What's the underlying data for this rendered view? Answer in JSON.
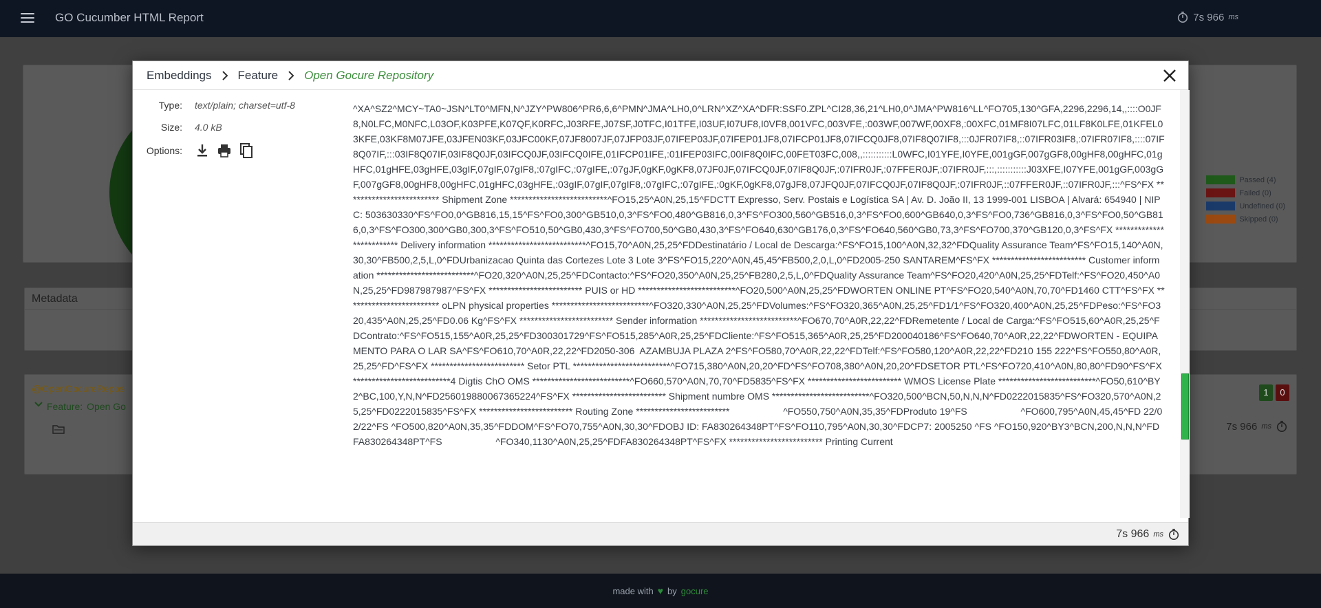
{
  "header": {
    "title": "GO Cucumber HTML Report",
    "time_value": "7s 966",
    "time_unit": "ms"
  },
  "background": {
    "legend": [
      {
        "label": "Passed (4)",
        "color": "#1f5a1b"
      },
      {
        "label": "Failed (0)",
        "color": "#6a1414"
      },
      {
        "label": "Undefined (0)",
        "color": "#1a3a6a"
      },
      {
        "label": "Skipped (0)",
        "color": "#9a4a10"
      }
    ],
    "metadata_title": "Metadata",
    "feature_tag": "@OpenGocureRepos",
    "feature_label": "Feature:",
    "feature_name": "Open Go",
    "passed_count": "1",
    "failed_count": "0",
    "feature_time": "7s 966",
    "feature_time_unit": "ms"
  },
  "modal": {
    "breadcrumb": [
      "Embeddings",
      "Feature",
      "Open Gocure Repository"
    ],
    "type_label": "Type:",
    "type_value": "text/plain; charset=utf-8",
    "size_label": "Size:",
    "size_value": "4.0 kB",
    "options_label": "Options:",
    "options": [
      "download-icon",
      "print-icon",
      "copy-icon"
    ],
    "content": "^XA^SZ2^MCY~TA0~JSN^LT0^MFN,N^JZY^PW806^PR6,6,6^PMN^JMA^LH0,0^LRN^XZ^XA^DFR:SSF0.ZPL^CI28,36,21^LH0,0^JMA^PW816^LL^FO705,130^GFA,2296,2296,14,,::::O0JF8,N0LFC,M0NFC,L03OF,K03PFE,K07QF,K0RFC,J03RFE,J07SF,J0TFC,I01TFE,I03UF,I07UF8,I0VF8,001VFC,003VFE,:003WF,007WF,00XF8,:00XFC,01MF8I07LFC,01LF8K0LFE,01KFEL03KFE,03KF8M07JFE,03JFEN03KF,03JFC00KF,07JF8007JF,07JFP03JF,07IFEP03JF,07IFEP01JF8,07IFCP01JF8,07IFCQ0JF8,07IF8Q07IF8,:::0JFR07IF8,::07IFR03IF8,:07IFR07IF8,::::07IF8Q07IF,:::03IF8Q07IF,03IF8Q0JF,03IFCQ0JF,03IFCQ0IFE,01IFCP01IFE,:01IFEP03IFC,00IF8Q0IFC,00FET03FC,008,,:::::::::::L0WFC,I01YFE,I0YFE,001gGF,007gGF8,00gHF8,00gHFC,01gHFC,01gHFE,03gHFE,03gIF,07gIF,07gIF8,:07gIFC,:07gIFE,:07gJF,0gKF,0gKF8,07JF0JF,07IFCQ0JF,07IF8Q0JF,:07IFR0JF,:07FFER0JF,:07IFR0JF,:::,:::::::::::J03XFE,I07YFE,001gGF,003gGF,007gGF8,00gHF8,00gHFC,01gHFC,03gHFE,:03gIF,07gIF,07gIF8,:07gIFC,:07gIFE,:0gKF,0gKF8,07gJF8,07JFQ0JF,07IFCQ0JF,07IF8Q0JF,:07IFR0JF,::07FFER0JF,::07IFR0JF,:::^FS^FX ************************* Shipment Zone **************************^FO15,25^A0N,25,15^FDCTT Expresso, Serv. Postais e Logística SA | Av. D. João II, 13 1999-001 LISBOA | Alvará: 654940 | NIPC: 503630330^FS^FO0,0^GB816,15,15^FS^FO0,300^GB510,0,3^FS^FO0,480^GB816,0,3^FS^FO300,560^GB516,0,3^FS^FO0,600^GB640,0,3^FS^FO0,736^GB816,0,3^FS^FO0,50^GB816,0,3^FS^FO300,300^GB0,300,3^FS^FO510,50^GB0,430,3^FS^FO700,50^GB0,430,3^FS^FO640,630^GB176,0,3^FS^FO640,560^GB0,73,3^FS^FO700,370^GB120,0,3^FS^FX ************************* Delivery information **************************^FO15,70^A0N,25,25^FDDestinatário / Local de Descarga:^FS^FO15,100^A0N,32,32^FDQuality Assurance Team^FS^FO15,140^A0N,30,30^FB500,2,5,L,0^FDUrbanizacao Quinta das Cortezes Lote 3 Lote 3^FS^FO15,220^A0N,45,45^FB500,2,0,L,0^FD2005-250 SANTAREM^FS^FX ************************* Customer information **************************^FO20,320^A0N,25,25^FDContacto:^FS^FO20,350^A0N,25,25^FB280,2,5,L,0^FDQuality Assurance Team^FS^FO20,420^A0N,25,25^FDTelf:^FS^FO20,450^A0N,25,25^FD987987987^FS^FX ************************* PUIS or HD **************************^FO20,500^A0N,25,25^FDWORTEN ONLINE PT^FS^FO20,540^A0N,70,70^FD1460 CTT^FS^FX ************************* oLPN physical properties **************************^FO320,330^A0N,25,25^FDVolumes:^FS^FO320,365^A0N,25,25^FD1/1^FS^FO320,400^A0N,25,25^FDPeso:^FS^FO320,435^A0N,25,25^FD0.06 Kg^FS^FX ************************* Sender information **************************^FO670,70^A0R,22,22^FDRemetente / Local de Carga:^FS^FO515,60^A0R,25,25^FDContrato:^FS^FO515,155^A0R,25,25^FD300301729^FS^FO515,285^A0R,25,25^FDCliente:^FS^FO515,365^A0R,25,25^FD200040186^FS^FO640,70^A0R,22,22^FDWORTEN - EQUIPAMENTO PARA O LAR SA^FS^FO610,70^A0R,22,22^FD2050-306  AZAMBUJA PLAZA 2^FS^FO580,70^A0R,22,22^FDTelf:^FS^FO580,120^A0R,22,22^FD210 155 222^FS^FO550,80^A0R,25,25^FD^FS^FX ************************* Setor PTL **************************^FO715,380^A0N,20,20^FD^FS^FO708,380^A0N,20,20^FDSETOR PTL^FS^FO720,410^A0N,80,80^FD90^FS^FX **************************4 Digtis ChO OMS **************************^FO660,570^A0N,70,70^FD5835^FS^FX ************************* WMOS License Plate **************************^FO50,610^BY2^BC,100,Y,N,N^FD256019880067365224^FS^FX ************************* Shipment numbre OMS **************************^FO320,500^BCN,50,N,N,N^FD0222015835^FS^FO320,570^A0N,25,25^FD0222015835^FS^FX ************************* Routing Zone *************************                    ^FO550,750^A0N,35,35^FDProduto 19^FS                    ^FO600,795^A0N,45,45^FD 22/02/22^FS ^FO500,820^A0N,35,35^FDDOM^FS^FO70,755^A0N,30,30^FDOBJ ID: FA830264348PT^FS^FO110,795^A0N,30,30^FDCP7: 2005250 ^FS ^FO150,920^BY3^BCN,200,N,N,N^FDFA830264348PT^FS                    ^FO340,1130^A0N,25,25^FDFA830264348PT^FS^FX ************************* Printing Current",
    "footer_time": "7s 966",
    "footer_time_unit": "ms"
  },
  "footer": {
    "made_with": "made with",
    "by": "by",
    "link": "gocure"
  }
}
